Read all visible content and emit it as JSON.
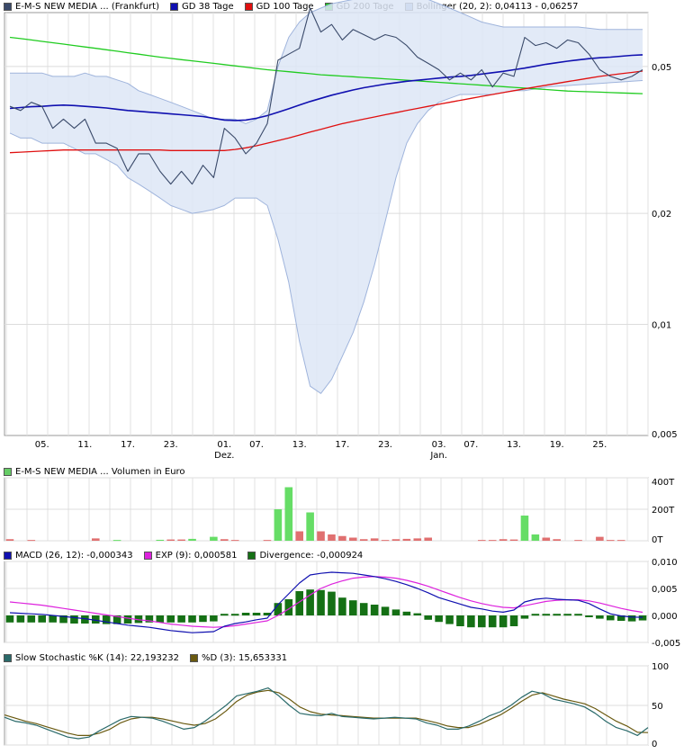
{
  "price_legend": [
    {
      "label": "E-M-S NEW MEDIA ... (Frankfurt)",
      "color": "#3a4a6a"
    },
    {
      "label": "GD 38 Tage",
      "color": "#1010b0"
    },
    {
      "label": "GD 100 Tage",
      "color": "#e01010"
    },
    {
      "label": "GD 200 Tage",
      "color": "#20cc20"
    },
    {
      "label": "Bollinger (20, 2): 0,04113 - 0,06257",
      "color": "#8fa8d8"
    }
  ],
  "volume_legend": [
    {
      "label": "E-M-S NEW MEDIA ... Volumen in Euro",
      "color": "#66cc66"
    }
  ],
  "macd_legend": [
    {
      "label": "MACD (26, 12): -0,000343",
      "color": "#1010b0"
    },
    {
      "label": "EXP (9): 0,000581",
      "color": "#dd22dd"
    },
    {
      "label": "Divergence: -0,000924",
      "color": "#157015"
    }
  ],
  "stoch_legend": [
    {
      "label": "Slow Stochastic %K (14): 22,193232",
      "color": "#2a6a6a"
    },
    {
      "label": "%D (3): 15,653331",
      "color": "#6a5a10"
    }
  ],
  "chart_data": [
    {
      "type": "line",
      "title": "E-M-S NEW MEDIA ... (Frankfurt)",
      "y_scale": "log",
      "ylim": [
        0.005,
        0.07
      ],
      "y_ticks": [
        "0,005",
        "0,01",
        "0,02",
        "0,05"
      ],
      "y_tick_values": [
        0.005,
        0.01,
        0.02,
        0.05
      ],
      "x_ticks": [
        "05.",
        "11.",
        "17.",
        "23.",
        "01.\nDez.",
        "07.",
        "13.",
        "17.",
        "23.",
        "03.\nJan.",
        "07.",
        "13.",
        "19.",
        "25."
      ],
      "x_tick_index": [
        3,
        7,
        11,
        15,
        20,
        23,
        27,
        31,
        35,
        40,
        43,
        47,
        51,
        55
      ],
      "n_points": 60,
      "series": [
        {
          "name": "E-M-S NEW MEDIA ... (Frankfurt)",
          "color": "#3a4a6a",
          "values": [
            0.039,
            0.038,
            0.04,
            0.039,
            0.034,
            0.036,
            0.034,
            0.036,
            0.031,
            0.031,
            0.03,
            0.026,
            0.029,
            0.029,
            0.026,
            0.024,
            0.026,
            0.024,
            0.027,
            0.025,
            0.034,
            0.032,
            0.029,
            0.031,
            0.035,
            0.052,
            0.054,
            0.056,
            0.072,
            0.062,
            0.065,
            0.059,
            0.063,
            0.061,
            0.059,
            0.061,
            0.06,
            0.057,
            0.053,
            0.051,
            0.049,
            0.046,
            0.048,
            0.046,
            0.049,
            0.044,
            0.048,
            0.047,
            0.06,
            0.057,
            0.058,
            0.056,
            0.059,
            0.058,
            0.054,
            0.049,
            0.047,
            0.046,
            0.047,
            0.049
          ]
        },
        {
          "name": "GD 38 Tage",
          "color": "#1010b0",
          "values": [
            0.0385,
            0.0387,
            0.0389,
            0.039,
            0.0392,
            0.0393,
            0.0392,
            0.039,
            0.0388,
            0.0386,
            0.0383,
            0.038,
            0.0378,
            0.0376,
            0.0374,
            0.0372,
            0.037,
            0.0368,
            0.0366,
            0.0362,
            0.0358,
            0.0357,
            0.0358,
            0.0362,
            0.0368,
            0.0376,
            0.0384,
            0.0393,
            0.0402,
            0.041,
            0.0418,
            0.0425,
            0.0432,
            0.0438,
            0.0443,
            0.0448,
            0.0452,
            0.0456,
            0.0459,
            0.0462,
            0.0465,
            0.0468,
            0.047,
            0.0473,
            0.0477,
            0.0481,
            0.0485,
            0.049,
            0.0495,
            0.0501,
            0.0507,
            0.0512,
            0.0517,
            0.0521,
            0.0525,
            0.0528,
            0.053,
            0.0533,
            0.0536,
            0.0538
          ]
        },
        {
          "name": "GD 100 Tage",
          "color": "#e01010",
          "values": [
            0.0292,
            0.0293,
            0.0294,
            0.0295,
            0.0296,
            0.0297,
            0.0297,
            0.0297,
            0.0297,
            0.0297,
            0.0297,
            0.0297,
            0.0297,
            0.0297,
            0.0297,
            0.0296,
            0.0296,
            0.0296,
            0.0296,
            0.0296,
            0.0296,
            0.0298,
            0.0301,
            0.0305,
            0.031,
            0.0315,
            0.032,
            0.0326,
            0.0332,
            0.0338,
            0.0344,
            0.035,
            0.0355,
            0.036,
            0.0365,
            0.037,
            0.0375,
            0.038,
            0.0385,
            0.039,
            0.0395,
            0.04,
            0.0405,
            0.041,
            0.0415,
            0.042,
            0.0425,
            0.043,
            0.0435,
            0.044,
            0.0445,
            0.045,
            0.0455,
            0.046,
            0.0465,
            0.047,
            0.0474,
            0.0478,
            0.0482,
            0.0486
          ]
        },
        {
          "name": "GD 200 Tage",
          "color": "#20cc20",
          "values": [
            0.06,
            0.0595,
            0.059,
            0.0585,
            0.058,
            0.0575,
            0.057,
            0.0565,
            0.056,
            0.0555,
            0.055,
            0.0545,
            0.054,
            0.0535,
            0.053,
            0.0526,
            0.0522,
            0.0518,
            0.0514,
            0.051,
            0.0506,
            0.0502,
            0.0498,
            0.0494,
            0.049,
            0.0487,
            0.0484,
            0.0481,
            0.0478,
            0.0475,
            0.0473,
            0.0471,
            0.0469,
            0.0467,
            0.0465,
            0.0463,
            0.0461,
            0.0459,
            0.0457,
            0.0455,
            0.0453,
            0.0451,
            0.0449,
            0.0447,
            0.0445,
            0.0443,
            0.0441,
            0.0439,
            0.0437,
            0.0435,
            0.0433,
            0.0431,
            0.0429,
            0.0428,
            0.0427,
            0.0426,
            0.0425,
            0.0424,
            0.0423,
            0.0422
          ]
        },
        {
          "name": "Bollinger Upper",
          "color": "#8fa8d8",
          "values": [
            0.048,
            0.048,
            0.048,
            0.048,
            0.047,
            0.047,
            0.047,
            0.048,
            0.047,
            0.047,
            0.046,
            0.045,
            0.043,
            0.042,
            0.041,
            0.04,
            0.039,
            0.038,
            0.037,
            0.036,
            0.036,
            0.036,
            0.035,
            0.036,
            0.038,
            0.05,
            0.06,
            0.066,
            0.07,
            0.072,
            0.074,
            0.075,
            0.076,
            0.077,
            0.078,
            0.078,
            0.078,
            0.077,
            0.077,
            0.076,
            0.074,
            0.072,
            0.07,
            0.068,
            0.066,
            0.065,
            0.064,
            0.064,
            0.064,
            0.064,
            0.064,
            0.064,
            0.064,
            0.064,
            0.0635,
            0.063,
            0.063,
            0.063,
            0.063,
            0.063
          ]
        },
        {
          "name": "Bollinger Lower",
          "color": "#8fa8d8",
          "values": [
            0.033,
            0.032,
            0.032,
            0.031,
            0.031,
            0.031,
            0.03,
            0.029,
            0.029,
            0.028,
            0.027,
            0.025,
            0.024,
            0.023,
            0.022,
            0.021,
            0.0205,
            0.02,
            0.0202,
            0.0205,
            0.021,
            0.022,
            0.022,
            0.022,
            0.021,
            0.017,
            0.013,
            0.009,
            0.0068,
            0.0065,
            0.0071,
            0.0082,
            0.0095,
            0.0115,
            0.0145,
            0.019,
            0.025,
            0.031,
            0.035,
            0.038,
            0.04,
            0.041,
            0.042,
            0.042,
            0.042,
            0.042,
            0.0425,
            0.043,
            0.043,
            0.0435,
            0.044,
            0.0442,
            0.0444,
            0.0446,
            0.0448,
            0.045,
            0.0452,
            0.0454,
            0.0456,
            0.0458
          ]
        }
      ]
    },
    {
      "type": "bar",
      "title": "E-M-S NEW MEDIA ... Volumen in Euro",
      "ylim": [
        0,
        400000
      ],
      "y_ticks": [
        "0T",
        "200T",
        "400T"
      ],
      "y_tick_values": [
        0,
        200000,
        400000
      ],
      "values": [
        10000,
        0,
        5000,
        0,
        0,
        0,
        0,
        0,
        15000,
        0,
        5000,
        0,
        0,
        0,
        6000,
        8000,
        8000,
        12000,
        0,
        25000,
        10000,
        5000,
        0,
        0,
        5000,
        200000,
        340000,
        60000,
        180000,
        60000,
        40000,
        30000,
        20000,
        10000,
        15000,
        5000,
        10000,
        12000,
        15000,
        20000,
        0,
        0,
        0,
        0,
        5000,
        5000,
        10000,
        8000,
        160000,
        40000,
        20000,
        10000,
        0,
        5000,
        0,
        25000,
        5000,
        5000,
        0,
        0
      ],
      "direction": [
        "down",
        "down",
        "down",
        "up",
        "down",
        "down",
        "down",
        "up",
        "down",
        "down",
        "up",
        "down",
        "up",
        "down",
        "up",
        "down",
        "down",
        "up",
        "down",
        "up",
        "down",
        "down",
        "up",
        "up",
        "down",
        "up",
        "up",
        "down",
        "up",
        "down",
        "down",
        "down",
        "down",
        "down",
        "down",
        "down",
        "down",
        "down",
        "down",
        "down",
        "down",
        "down",
        "down",
        "down",
        "down",
        "down",
        "down",
        "down",
        "up",
        "up",
        "down",
        "down",
        "down",
        "down",
        "down",
        "down",
        "down",
        "down",
        "down",
        "down"
      ],
      "up_color": "#66dd66",
      "down_color": "#e07070"
    },
    {
      "type": "line",
      "title": "MACD (26, 12)",
      "ylim": [
        -0.005,
        0.01
      ],
      "y_ticks": [
        "-0,005",
        "0,000",
        "0,005",
        "0,010"
      ],
      "y_tick_values": [
        -0.005,
        0,
        0.005,
        0.01
      ],
      "series": [
        {
          "name": "MACD (26, 12): -0,000343",
          "color": "#1010b0",
          "values": [
            0.0005,
            0.0004,
            0.0003,
            0.0002,
            0.0,
            -0.0002,
            -0.0004,
            -0.0006,
            -0.0009,
            -0.0012,
            -0.0015,
            -0.0018,
            -0.002,
            -0.0022,
            -0.0025,
            -0.0028,
            -0.003,
            -0.0032,
            -0.0031,
            -0.003,
            -0.002,
            -0.0015,
            -0.0012,
            -0.0008,
            -0.0005,
            0.002,
            0.004,
            0.006,
            0.0075,
            0.0078,
            0.008,
            0.0079,
            0.0078,
            0.0075,
            0.0072,
            0.0068,
            0.0063,
            0.0057,
            0.005,
            0.0042,
            0.0033,
            0.0027,
            0.0021,
            0.0015,
            0.0012,
            0.0008,
            0.0006,
            0.001,
            0.0025,
            0.003,
            0.0032,
            0.003,
            0.0029,
            0.0028,
            0.0022,
            0.0012,
            0.0003,
            -0.0001,
            -0.0003,
            -0.000343
          ]
        },
        {
          "name": "EXP (9): 0,000581",
          "color": "#dd22dd",
          "values": [
            0.0025,
            0.0023,
            0.0021,
            0.0019,
            0.0016,
            0.0013,
            0.001,
            0.0007,
            0.0004,
            0.0001,
            -0.0002,
            -0.0005,
            -0.0008,
            -0.001,
            -0.0013,
            -0.0016,
            -0.0018,
            -0.002,
            -0.0021,
            -0.0022,
            -0.0021,
            -0.0019,
            -0.0016,
            -0.0013,
            -0.001,
            0.0,
            0.0012,
            0.0025,
            0.0038,
            0.005,
            0.0058,
            0.0064,
            0.0069,
            0.0071,
            0.0072,
            0.0071,
            0.0069,
            0.0065,
            0.006,
            0.0054,
            0.0047,
            0.004,
            0.0033,
            0.0027,
            0.0022,
            0.0018,
            0.0015,
            0.0014,
            0.0018,
            0.0022,
            0.0026,
            0.0028,
            0.0029,
            0.0029,
            0.0027,
            0.0023,
            0.0018,
            0.0013,
            0.0009,
            0.000581
          ]
        },
        {
          "name": "Divergence: -0,000924",
          "color": "#157015",
          "type": "bar",
          "values": [
            -0.0013,
            -0.0013,
            -0.0013,
            -0.0013,
            -0.0013,
            -0.0014,
            -0.0015,
            -0.0015,
            -0.0015,
            -0.0016,
            -0.0016,
            -0.0015,
            -0.0014,
            -0.0013,
            -0.0013,
            -0.0013,
            -0.0013,
            -0.0013,
            -0.0012,
            -0.0011,
            0.0003,
            0.0003,
            0.0005,
            0.0005,
            0.0005,
            0.0023,
            0.003,
            0.0045,
            0.0048,
            0.0047,
            0.0044,
            0.0033,
            0.0028,
            0.0023,
            0.002,
            0.0016,
            0.0011,
            0.0007,
            0.0004,
            -0.0008,
            -0.0012,
            -0.0016,
            -0.002,
            -0.0022,
            -0.0022,
            -0.0022,
            -0.0022,
            -0.002,
            -0.0006,
            0.0003,
            0.0003,
            0.0003,
            0.0003,
            0.0003,
            -0.0002,
            -0.0006,
            -0.0009,
            -0.001,
            -0.0011,
            -0.000924
          ]
        }
      ]
    },
    {
      "type": "line",
      "title": "Slow Stochastic",
      "ylim": [
        0,
        100
      ],
      "y_ticks": [
        "0",
        "50",
        "100"
      ],
      "y_tick_values": [
        0,
        50,
        100
      ],
      "series": [
        {
          "name": "Slow Stochastic %K (14): 22,193232",
          "color": "#2a6a6a",
          "values": [
            35,
            30,
            28,
            25,
            20,
            15,
            10,
            8,
            10,
            18,
            25,
            32,
            36,
            35,
            34,
            30,
            25,
            20,
            22,
            30,
            40,
            50,
            62,
            65,
            68,
            72,
            62,
            50,
            40,
            38,
            37,
            40,
            36,
            35,
            34,
            33,
            34,
            35,
            34,
            33,
            28,
            25,
            20,
            20,
            24,
            30,
            37,
            42,
            50,
            60,
            68,
            65,
            58,
            55,
            52,
            48,
            40,
            30,
            22,
            18,
            12,
            22
          ]
        },
        {
          "name": "%D (3): 15,653331",
          "color": "#6a5a10",
          "values": [
            38,
            34,
            30,
            27,
            23,
            19,
            15,
            12,
            12,
            15,
            20,
            28,
            33,
            35,
            35,
            33,
            30,
            27,
            25,
            27,
            33,
            43,
            55,
            63,
            67,
            69,
            66,
            58,
            48,
            42,
            39,
            38,
            37,
            36,
            35,
            34,
            34,
            34,
            34,
            34,
            31,
            28,
            24,
            22,
            22,
            26,
            32,
            38,
            46,
            55,
            63,
            66,
            62,
            58,
            55,
            52,
            46,
            38,
            30,
            24,
            16,
            15.65
          ]
        }
      ]
    }
  ]
}
